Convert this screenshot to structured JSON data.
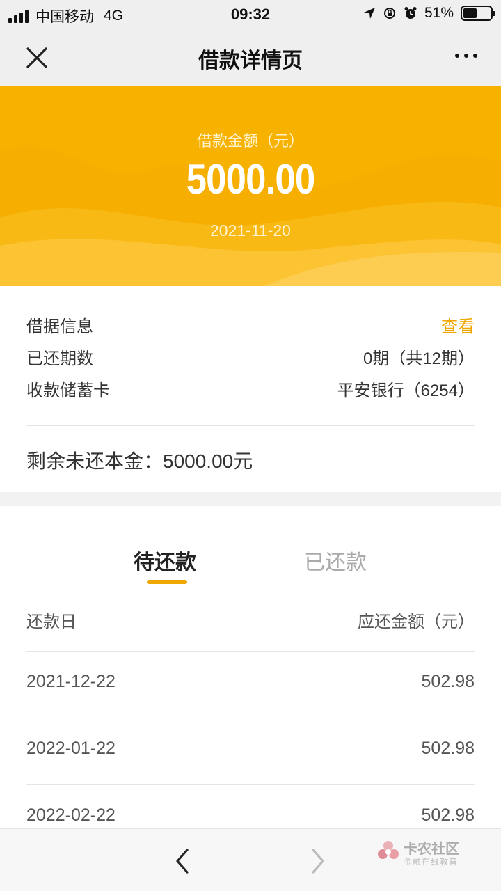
{
  "status_bar": {
    "carrier": "中国移动",
    "network": "4G",
    "time": "09:32",
    "battery": "51%",
    "battery_level": 0.51
  },
  "nav": {
    "title": "借款详情页",
    "close_icon": "close-icon",
    "more_icon": "more-icon"
  },
  "hero": {
    "label": "借款金额（元）",
    "amount": "5000.00",
    "date": "2021-11-20",
    "color": "#f7b200"
  },
  "info": {
    "rows": [
      {
        "key": "借据信息",
        "value": "查看"
      },
      {
        "key": "已还期数",
        "value": "0期（共12期）"
      },
      {
        "key": "收款储蓄卡",
        "value": "平安银行（6254）"
      }
    ],
    "remaining": "剩余未还本金：5000.00元"
  },
  "tabs": [
    {
      "label": "待还款",
      "active": true
    },
    {
      "label": "已还款",
      "active": false
    }
  ],
  "list": {
    "header": {
      "date": "还款日",
      "amount": "应还金额（元）"
    },
    "rows": [
      {
        "date": "2021-12-22",
        "amount": "502.98"
      },
      {
        "date": "2022-01-22",
        "amount": "502.98"
      },
      {
        "date": "2022-02-22",
        "amount": "502.98"
      }
    ]
  },
  "bottom": {
    "back_icon": "chevron-left-icon",
    "forward_icon": "chevron-right-icon"
  },
  "watermark": {
    "title": "卡农社区",
    "subtitle": "金融在线教育"
  },
  "colors": {
    "accent": "#f0a800",
    "hero": "#f7b200"
  }
}
